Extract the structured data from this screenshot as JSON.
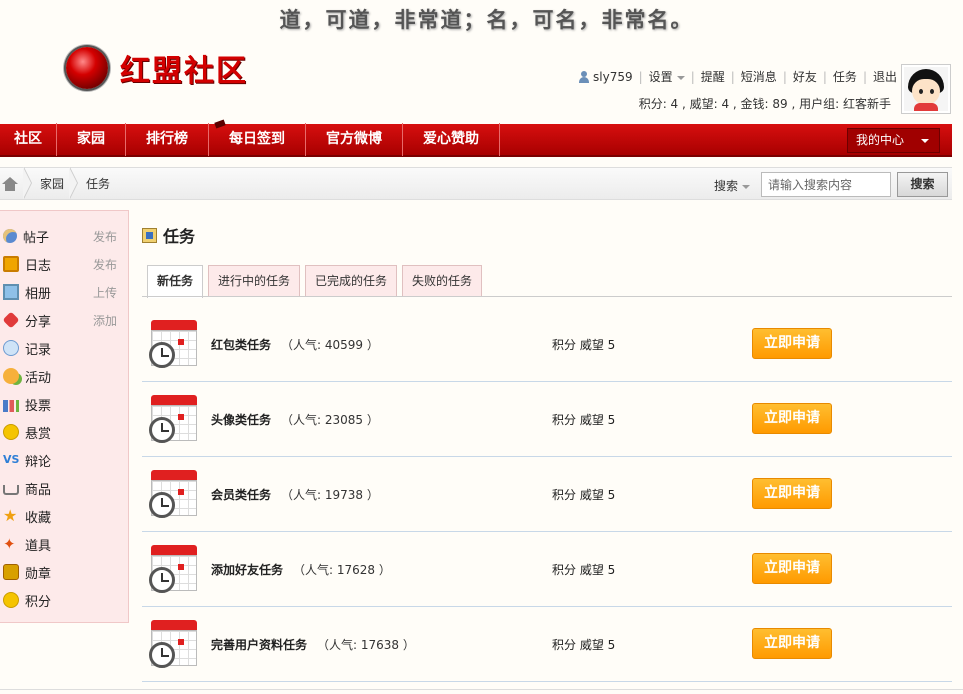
{
  "slogan": "道，可道，非常道；名，可名，非常名。",
  "logo": {
    "text": "红盟社区"
  },
  "user": {
    "name": "sly759",
    "links": [
      "设置",
      "提醒",
      "短消息",
      "好友",
      "任务",
      "退出"
    ],
    "stats": "积分: 4 , 威望: 4 , 金钱: 89 , 用户组: 红客新手"
  },
  "nav": {
    "items": [
      "社区",
      "家园",
      "排行榜",
      "每日签到",
      "官方微博",
      "爱心赞助"
    ],
    "center_label": "我的中心"
  },
  "breadcrumb": [
    "家园",
    "任务"
  ],
  "search": {
    "label": "搜索",
    "placeholder": "请输入搜索内容",
    "button": "搜索"
  },
  "sidebar": [
    {
      "label": "帖子",
      "action": "发布",
      "icon": "post-icon"
    },
    {
      "label": "日志",
      "action": "发布",
      "icon": "blog-icon"
    },
    {
      "label": "相册",
      "action": "上传",
      "icon": "album-icon"
    },
    {
      "label": "分享",
      "action": "添加",
      "icon": "share-icon"
    },
    {
      "label": "记录",
      "action": "",
      "icon": "record-icon"
    },
    {
      "label": "活动",
      "action": "",
      "icon": "activity-icon"
    },
    {
      "label": "投票",
      "action": "",
      "icon": "poll-icon"
    },
    {
      "label": "悬赏",
      "action": "",
      "icon": "reward-icon"
    },
    {
      "label": "辩论",
      "action": "",
      "icon": "debate-icon"
    },
    {
      "label": "商品",
      "action": "",
      "icon": "goods-icon"
    },
    {
      "label": "收藏",
      "action": "",
      "icon": "favorite-icon"
    },
    {
      "label": "道具",
      "action": "",
      "icon": "tool-icon"
    },
    {
      "label": "勋章",
      "action": "",
      "icon": "medal-icon"
    },
    {
      "label": "积分",
      "action": "",
      "icon": "credit-icon"
    }
  ],
  "page_title": "任务",
  "tabs": [
    "新任务",
    "进行中的任务",
    "已完成的任务",
    "失败的任务"
  ],
  "tasks": [
    {
      "name": "红包类任务",
      "popularity": "（人气: 40599 ）",
      "reward": "积分 威望 5",
      "button": "立即申请"
    },
    {
      "name": "头像类任务",
      "popularity": "（人气: 23085 ）",
      "reward": "积分 威望 5",
      "button": "立即申请"
    },
    {
      "name": "会员类任务",
      "popularity": "（人气: 19738 ）",
      "reward": "积分 威望 5",
      "button": "立即申请"
    },
    {
      "name": "添加好友任务",
      "popularity": "（人气: 17628 ）",
      "reward": "积分 威望 5",
      "button": "立即申请"
    },
    {
      "name": "完善用户资料任务",
      "popularity": "（人气: 17638 ）",
      "reward": "积分 威望 5",
      "button": "立即申请"
    }
  ],
  "colors": {
    "nav_red": "#c40000",
    "apply_orange": "#ff9a00",
    "sidebar_bg": "#fdeaea"
  }
}
